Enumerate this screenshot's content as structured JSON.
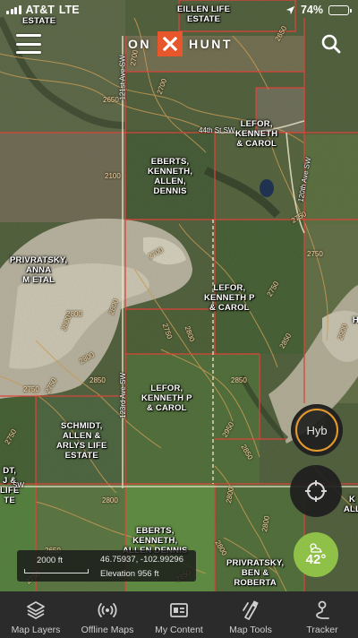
{
  "status_bar": {
    "carrier": "AT&T",
    "network": "LTE",
    "battery_percent": "74%",
    "battery_level": 0.74
  },
  "header": {
    "logo_left": "ON",
    "logo_right": "HUNT",
    "icons": [
      "menu-icon",
      "onx-logo-icon",
      "search-icon"
    ]
  },
  "map": {
    "owners": [
      {
        "lines": [
          "EILLEN LIFE",
          "ESTATE"
        ]
      },
      {
        "lines": [
          "ESTATE"
        ]
      },
      {
        "lines": [
          "LEFOR,",
          "KENNETH",
          "& CAROL"
        ]
      },
      {
        "lines": [
          "EBERTS,",
          "KENNETH,",
          "ALLEN,",
          "DENNIS"
        ]
      },
      {
        "lines": [
          "PRIVRATSKY,",
          "ANNA",
          "M ETAL"
        ]
      },
      {
        "lines": [
          "LEFOR,",
          "KENNETH P",
          "& CAROL"
        ]
      },
      {
        "lines": [
          "LEFOR,",
          "KENNETH P",
          "& CAROL"
        ]
      },
      {
        "lines": [
          "SCHMIDT,",
          "ALLEN &",
          "ARLYS LIFE",
          "ESTATE"
        ]
      },
      {
        "lines": [
          "DT,",
          "J &",
          "LIFE",
          "TE"
        ]
      },
      {
        "lines": [
          "EBERTS,",
          "KENNETH,",
          "ALLEN DENNIS"
        ]
      },
      {
        "lines": [
          "PRIVRATSKY,",
          "BEN &",
          "ROBERTA"
        ]
      },
      {
        "lines": [
          "K",
          "ALL"
        ]
      },
      {
        "lines": [
          "H"
        ]
      }
    ],
    "roads": [
      "121st Ave SW",
      "44th St SW",
      "120th Ave SW",
      "123rd Ave SW",
      "SW"
    ],
    "contours": [
      "2650",
      "2700",
      "2650",
      "2100",
      "2700",
      "2750",
      "2750",
      "2700",
      "2800",
      "2800",
      "2800",
      "2750",
      "2850",
      "2750",
      "2800",
      "2850",
      "2900",
      "2750",
      "2800",
      "2850",
      "2750",
      "2750",
      "2850",
      "2950",
      "2800",
      "2800",
      "2800",
      "2800",
      "2850",
      "2750",
      "2700",
      "2650"
    ]
  },
  "controls": {
    "layer_toggle": "Hyb",
    "locate_icon": "crosshair-icon",
    "temperature": "42°",
    "weather_icon": "partly-cloudy-icon",
    "accent": "#e89a2c",
    "weather_color": "#8fc048"
  },
  "info_panel": {
    "scale": "2000 ft",
    "coordinates": "46.75937, -102.99296",
    "elevation": "Elevation 956 ft"
  },
  "tabbar": {
    "items": [
      {
        "label": "Map Layers",
        "icon": "layers-icon"
      },
      {
        "label": "Offline Maps",
        "icon": "offline-signal-icon"
      },
      {
        "label": "My Content",
        "icon": "content-card-icon"
      },
      {
        "label": "Map Tools",
        "icon": "tools-icon"
      },
      {
        "label": "Tracker",
        "icon": "tracker-pin-icon"
      }
    ]
  },
  "colors": {
    "brand": "#e8562b",
    "parcel_line": "#d9443a",
    "tab_background": "#2b2b2b"
  }
}
